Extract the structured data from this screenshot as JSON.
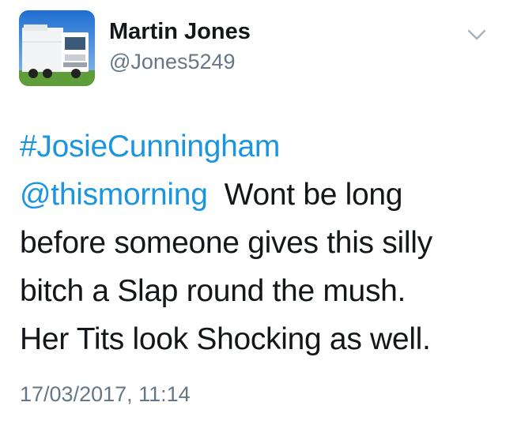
{
  "author": {
    "name": "Martin Jones",
    "handle": "@Jones5249",
    "avatar_icon": "truck-avatar"
  },
  "menu_icon": "chevron-down-icon",
  "tweet": {
    "hashtag": "#JosieCunningham",
    "mention": "@thismorning",
    "text_line_1": "Wont be long",
    "text_line_2": "before someone gives this silly",
    "text_line_3": "bitch a Slap round the mush.",
    "text_line_4": "Her Tits look Shocking as well."
  },
  "timestamp": "17/03/2017, 11:14",
  "colors": {
    "link": "#1b95e0",
    "text": "#14171a",
    "secondary": "#657786"
  }
}
